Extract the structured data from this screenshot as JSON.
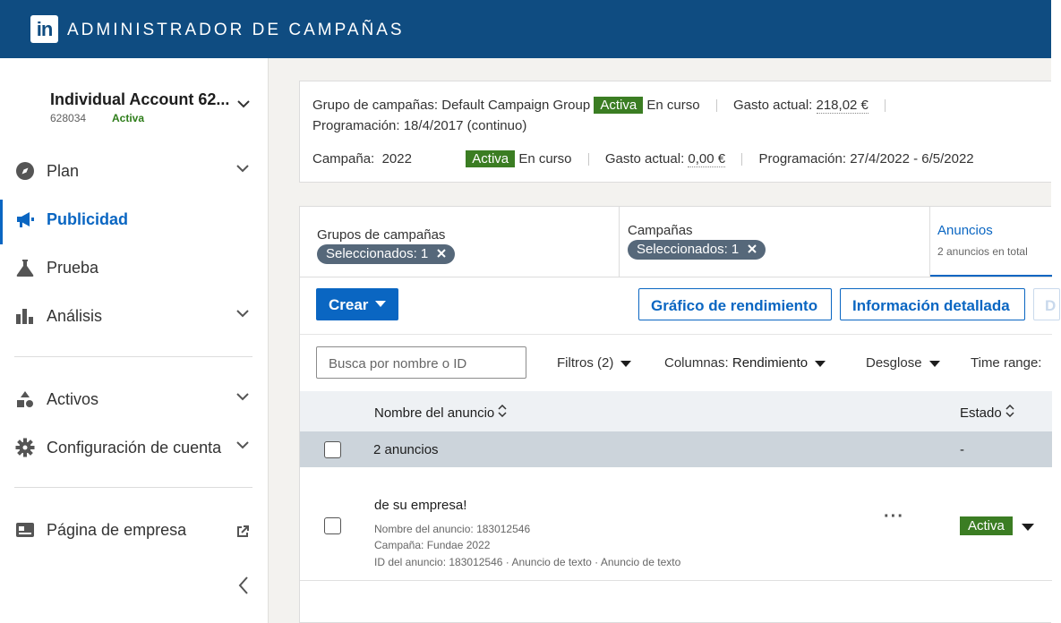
{
  "header": {
    "logo_text": "in",
    "title": "ADMINISTRADOR DE CAMPAÑAS"
  },
  "account": {
    "name": "Individual Account 62...",
    "id": "628034",
    "status": "Activa"
  },
  "nav": {
    "plan": "Plan",
    "publicidad": "Publicidad",
    "prueba": "Prueba",
    "analisis": "Análisis",
    "activos": "Activos",
    "configuracion": "Configuración de cuenta",
    "pagina_empresa": "Página de empresa"
  },
  "summary": {
    "group_label": "Grupo de campañas: Default Campaign Group",
    "group_status": "Activa",
    "group_state": "En curso",
    "group_spend_label": "Gasto actual:",
    "group_spend_value": "218,02 €",
    "group_schedule": "Programación: 18/4/2017 (continuo)",
    "campaign_label": "Campaña:",
    "campaign_name": "2022",
    "campaign_status": "Activa",
    "campaign_state": "En curso",
    "campaign_spend_label": "Gasto actual:",
    "campaign_spend_value": "0,00 €",
    "campaign_schedule": "Programación: 27/4/2022 - 6/5/2022"
  },
  "tabs": {
    "groups_title": "Grupos de campañas",
    "groups_chip": "Seleccionados: 1",
    "campaigns_title": "Campañas",
    "campaigns_chip": "Seleccionados: 1",
    "ads_title": "Anuncios",
    "ads_sub": "2 anuncios en total"
  },
  "actions": {
    "create": "Crear",
    "performance_chart": "Gráfico de rendimiento",
    "detailed_info": "Información detallada",
    "cut_button": "D"
  },
  "toolbar": {
    "search_placeholder": "Busca por nombre o ID",
    "filters": "Filtros (2)",
    "columns_label": "Columnas:",
    "columns_value": "Rendimiento",
    "breakdown": "Desglose",
    "time_range": "Time range:"
  },
  "table": {
    "col_name": "Nombre del anuncio",
    "col_status": "Estado",
    "group_row_label": "2 anuncios",
    "group_row_status": "-",
    "ad": {
      "title": "de su empresa!",
      "name_meta": "Nombre del anuncio: 183012546",
      "campaign_meta": "Campaña: Fundae 2022",
      "id_meta": "ID del anuncio: 183012546 · Anuncio de texto · Anuncio de texto",
      "status": "Activa",
      "more": "···"
    }
  },
  "colors": {
    "header": "#0f4c81",
    "accent": "#0a66c2",
    "active_badge": "#3b7d23",
    "chip": "#56687a"
  },
  "icons": [
    "compass-icon",
    "megaphone-icon",
    "flask-icon",
    "bar-chart-icon",
    "shapes-icon",
    "gear-icon",
    "company-page-icon",
    "external-link-icon",
    "chevron-down-icon",
    "chevron-left-icon",
    "close-icon",
    "sort-icon"
  ]
}
